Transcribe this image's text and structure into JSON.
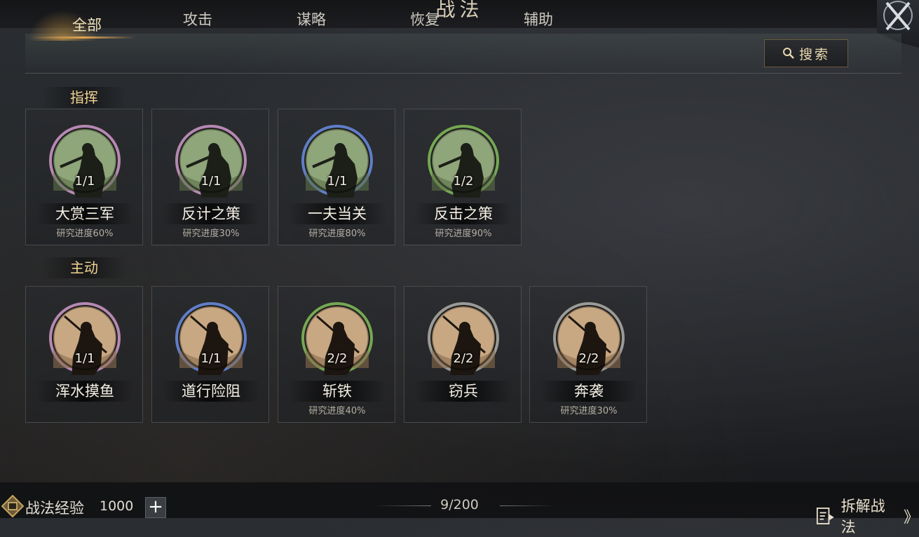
{
  "header": {
    "title": "战法"
  },
  "colors": {
    "accent": "#e1a552",
    "section_label": "#f2d492"
  },
  "tabs": [
    {
      "label": "全部",
      "active": true
    },
    {
      "label": "攻击",
      "active": false
    },
    {
      "label": "谋略",
      "active": false
    },
    {
      "label": "恢复",
      "active": false
    },
    {
      "label": "辅助",
      "active": false
    }
  ],
  "search": {
    "label": "搜索",
    "icon": "search-icon"
  },
  "sections": [
    {
      "label": "指挥",
      "cards": [
        {
          "name": "大赏三军",
          "count": "1/1",
          "progress": "研究进度60%",
          "ring": "#b588b4",
          "art": "commander"
        },
        {
          "name": "反计之策",
          "count": "1/1",
          "progress": "研究进度30%",
          "ring": "#b588b4",
          "art": "commander"
        },
        {
          "name": "一夫当关",
          "count": "1/1",
          "progress": "研究进度80%",
          "ring": "#5f7ec9",
          "art": "commander"
        },
        {
          "name": "反击之策",
          "count": "1/2",
          "progress": "研究进度90%",
          "ring": "#74a855",
          "art": "commander"
        }
      ]
    },
    {
      "label": "主动",
      "cards": [
        {
          "name": "浑水摸鱼",
          "count": "1/1",
          "progress": "",
          "ring": "#b588b4",
          "art": "warrior"
        },
        {
          "name": "道行险阻",
          "count": "1/1",
          "progress": "",
          "ring": "#5f7ec9",
          "art": "warrior"
        },
        {
          "name": "斩铁",
          "count": "2/2",
          "progress": "研究进度40%",
          "ring": "#74a855",
          "art": "warrior"
        },
        {
          "name": "窃兵",
          "count": "2/2",
          "progress": "",
          "ring": "#9a9a98",
          "art": "warrior"
        },
        {
          "name": "奔袭",
          "count": "2/2",
          "progress": "研究进度30%",
          "ring": "#9a9a98",
          "art": "warrior"
        }
      ]
    }
  ],
  "footer": {
    "exp_label": "战法经验",
    "exp_value": "1000",
    "plus": "+",
    "page_count": "9/200",
    "dismantle_label": "拆解战法",
    "dismantle_chevron": "》"
  }
}
